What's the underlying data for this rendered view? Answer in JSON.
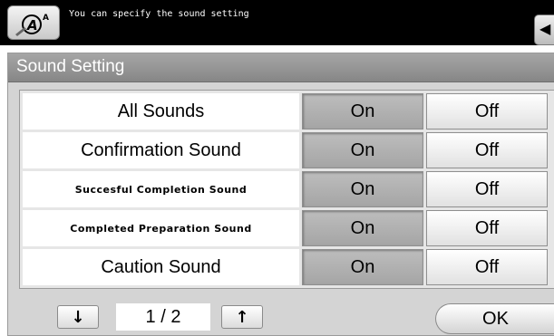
{
  "header": {
    "message": "You can specify the sound setting",
    "hint_icon": "pen-hint-icon",
    "side_tab_icon": "arrow-left-icon",
    "side_tab_glyph": "◀"
  },
  "panel": {
    "title": "Sound Setting"
  },
  "settings": [
    {
      "label": "All Sounds",
      "on": "On",
      "off": "Off",
      "selected": "On"
    },
    {
      "label": "Confirmation Sound",
      "on": "On",
      "off": "Off",
      "selected": "On"
    },
    {
      "label": "Succesful Completion Sound",
      "on": "On",
      "off": "Off",
      "selected": "On"
    },
    {
      "label": "Completed Preparation Sound",
      "on": "On",
      "off": "Off",
      "selected": "On"
    },
    {
      "label": "Caution Sound",
      "on": "On",
      "off": "Off",
      "selected": "On"
    }
  ],
  "pager": {
    "down_glyph": "↓",
    "up_glyph": "↑",
    "page": "1 / 2"
  },
  "ok_label": "OK",
  "colors": {
    "topbar": "#000000",
    "panel": "#d4d4d4",
    "titlebar": "#969696",
    "selected_option": "#b2b2b2"
  }
}
